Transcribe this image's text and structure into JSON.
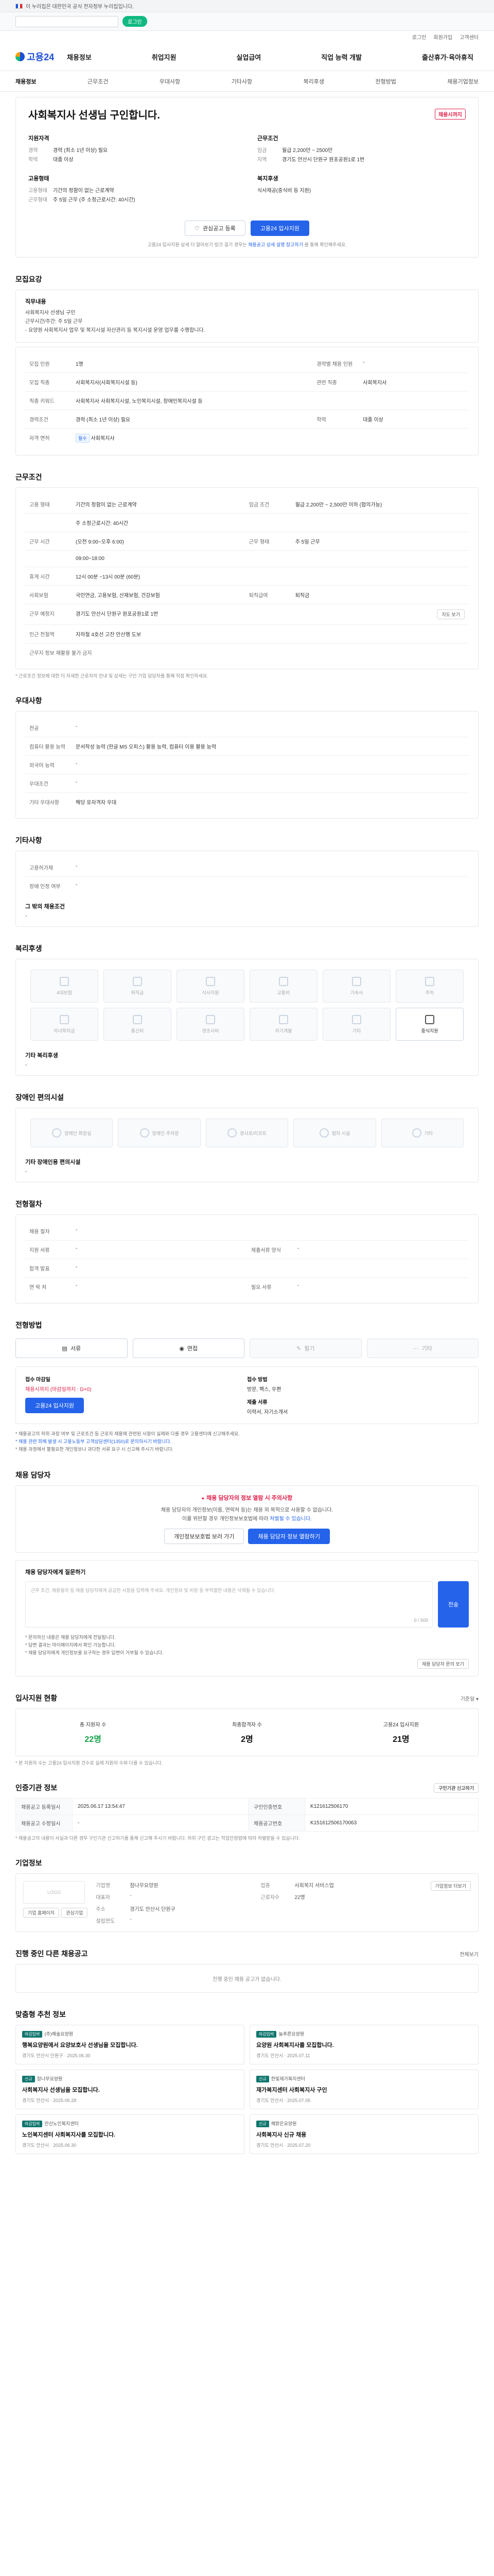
{
  "gov": {
    "text": "이 누리집은 대한민국 공식 전자정부 누리집입니다."
  },
  "notice": {
    "placeholder": "",
    "pill": "로그인"
  },
  "util": [
    "로그인",
    "회원가입",
    "고객센터"
  ],
  "logo": "고용24",
  "gnb": [
    "채용정보",
    "취업지원",
    "실업급여",
    "직업 능력 개발",
    "출산휴가·육아휴직"
  ],
  "subnav": [
    {
      "label": "채용정보",
      "active": true
    },
    {
      "label": "근무조건",
      "active": false
    },
    {
      "label": "우대사항",
      "active": false
    },
    {
      "label": "기타사항",
      "active": false
    },
    {
      "label": "복리후생",
      "active": false
    },
    {
      "label": "전형방법",
      "active": false
    },
    {
      "label": "채용기업정보",
      "active": false
    }
  ],
  "job": {
    "title": "사회복지사 선생님 구인합니다.",
    "tag": "채용시까지",
    "summary": {
      "left_head": "지원자격",
      "left_rows": [
        {
          "k": "경력",
          "v": "경력 (최소 1년 이상) 필요"
        },
        {
          "k": "학력",
          "v": "대졸 이상"
        }
      ],
      "right_head": "근무조건",
      "right_rows": [
        {
          "k": "임금",
          "v": "월급 2,200만 ~ 2500만"
        },
        {
          "k": "지역",
          "v": "경기도 안산시 단원구 원포공원1로 1번"
        }
      ],
      "left_head2": "고용형태",
      "left_rows2": [
        {
          "k": "고용형태",
          "v": "기간의 정함이 없는 근로계약"
        },
        {
          "k": "근무형태",
          "v": "주 5일 근무 (주 소정근로시간: 40시간)"
        }
      ],
      "right_head2": "복지후생",
      "right_rows2": [
        {
          "k": "",
          "v": "식사제공(중식비 등 지원)"
        }
      ]
    },
    "btn_save": "관심공고 등록",
    "btn_apply": "고용24 입사지원",
    "note_pre": "고용24 입사지원 상세 더 알아보기 링크 걸기 경우는",
    "note_link": "채용공고 상세 설명 참고하기",
    "note_post": "를 통해 확인해주세요."
  },
  "sec_recruit": {
    "title": "모집요강",
    "duty_head": "직무내용",
    "duty_lines": [
      "사회복지사 선생님 구인",
      "근무시간/주간: 주 5일 근무",
      "- 요양원 사회복지사 업무 및 복지시설 자산관리 등 복지시설 운영 업무를 수행합니다."
    ],
    "rows": [
      {
        "k": "모집 인원",
        "v": "1명",
        "k2": "경력별 채용 인원",
        "v2": "-"
      },
      {
        "k": "모집 직종",
        "v": "사회복지사(사회복지시설 등)",
        "k2": "관련 직종",
        "v2": "사회복지사"
      },
      {
        "k": "직종 키워드",
        "v": "사회복지사 사회복지시설, 노인복지시설, 장애인복지시설 등",
        "k2": "",
        "v2": ""
      },
      {
        "k": "경력조건",
        "v": "경력 (최소 1년 이상) 필요",
        "k2": "학력",
        "v2": "대졸 이상"
      },
      {
        "k": "자격 면허",
        "v": "사회복지사",
        "k2": "",
        "v2": ""
      }
    ],
    "tag": "필수"
  },
  "sec_work": {
    "title": "근무조건",
    "rows": [
      {
        "k": "고용 형태",
        "v": "기간의 정함이 없는 근로계약",
        "k2": "임금 조건",
        "v2": "월급 2,200만 ~ 2,500만 이하 (협의가능)"
      },
      {
        "k": "",
        "v": "주 소정근로시간: 40시간",
        "k2": "",
        "v2": ""
      },
      {
        "k": "근무 시간",
        "v": "(오전 9:00~오후 6:00)",
        "k2": "근무 형태",
        "v2": "주 5일 근무"
      },
      {
        "k": "",
        "v": "09:00~18:00",
        "k2": "",
        "v2": ""
      },
      {
        "k": "휴게 시간",
        "v": "12시 00분 ~13시 00분 (60분)",
        "k2": "",
        "v2": ""
      },
      {
        "k": "사회보험",
        "v": "국민연금, 고용보험, 산재보험, 건강보험",
        "k2": "퇴직급여",
        "v2": "퇴직금"
      },
      {
        "k": "근무 예정지",
        "v": "경기도 안산시 단원구 원포공원1로 1번",
        "k2": "",
        "v2": ""
      },
      {
        "k": "인근 전철역",
        "v": "지하철 4호선 고잔 안산행 도보",
        "k2": "",
        "v2": ""
      }
    ],
    "sel": "지도 보기",
    "note": "근무지 정보 재활용 불가 금지",
    "footnote": "* 근로조건 정보에 대한 더 자세한 근로자의 안내 및 상세는 구인 기업 담당자를 통해 직접 확인하세요."
  },
  "sec_pref": {
    "title": "우대사항",
    "rows": [
      {
        "k": "전공",
        "v": "-"
      },
      {
        "k": "컴퓨터 활용 능력",
        "v": "문서작성 능력 (한글 MS 오피스) 활용 능력, 컴퓨터 이용 활용 능력"
      },
      {
        "k": "외국어 능력",
        "v": "-"
      },
      {
        "k": "우대조건",
        "v": "-"
      },
      {
        "k": "기타 우대사항",
        "v": "해당 유자격자 우대"
      }
    ]
  },
  "sec_etc": {
    "title": "기타사항",
    "rows": [
      {
        "k": "고용허가제",
        "v": "-"
      },
      {
        "k": "장애 인정 여부",
        "v": "-"
      }
    ],
    "extra_head": "그 밖의 채용조건",
    "extra_v": "-"
  },
  "sec_welfare": {
    "title": "복리후생",
    "items": [
      {
        "label": "4대보험",
        "on": false
      },
      {
        "label": "퇴직금",
        "on": false
      },
      {
        "label": "식사지원",
        "on": false
      },
      {
        "label": "교통비",
        "on": false
      },
      {
        "label": "기숙사",
        "on": false
      },
      {
        "label": "주차",
        "on": false
      },
      {
        "label": "자녀학자금",
        "on": false
      },
      {
        "label": "통신비",
        "on": false
      },
      {
        "label": "경조사비",
        "on": false
      },
      {
        "label": "자기계발",
        "on": false
      },
      {
        "label": "기타",
        "on": false
      },
      {
        "label": "중식지원",
        "on": true
      }
    ],
    "note_head": "기타 복리후생",
    "note_v": "-"
  },
  "sec_disable": {
    "title": "장애인 편의시설",
    "items": [
      "장애인 화장실",
      "장애인 주차장",
      "경사로/리프트",
      "점자 시설",
      "기타"
    ],
    "note_head": "기타 장애인용 편의시설",
    "note_v": "-"
  },
  "sec_screen": {
    "title": "전형절차",
    "rows": [
      {
        "k": "채용 절차",
        "v": "-",
        "k2": "",
        "v2": ""
      },
      {
        "k": "지원 서류",
        "v": "-",
        "k2": "제출서류 양식",
        "v2": "-"
      },
      {
        "k": "합격 발표",
        "v": "-",
        "k2": "",
        "v2": ""
      },
      {
        "k": "연 락 처",
        "v": "-",
        "k2": "필요 서류",
        "v2": "-"
      }
    ]
  },
  "sec_apply": {
    "title": "전형방법",
    "methods": [
      {
        "label": "서류",
        "on": true
      },
      {
        "label": "면접",
        "on": true
      },
      {
        "label": "필기",
        "on": false
      },
      {
        "label": "기타",
        "on": false
      }
    ],
    "deadline_label": "접수 마감일",
    "deadline_v": "채용시까지 (마감일까지 : D+0)",
    "how_label": "접수 방법",
    "how_v": "방문, 팩스, 우편",
    "btn": "고용24 입사지원",
    "doc_label": "제출 서류",
    "doc_v": "이력서, 자기소개서",
    "bullets": [
      "* 채용공고의 허위·과장 여부 및 근로조건 등 근로자 채용에 관련된 사항이 실제와 다를 경우 고용센터에 신고해주세요.",
      "* 채용 관련 피해 발생 시 고용노동부 고객상담센터(1350)로 문의하시기 바랍니다.",
      "* 채용 과정에서 불필요한 개인정보나 과다한 서류 요구 시 신고해 주시기 바랍니다."
    ]
  },
  "caution": {
    "title": "채용 담당자",
    "head": "채용 담당자의 정보 열람 시 주의사항",
    "l1": "채용 담당자의 개인정보(이름, 연락처 등)는 채용 외 목적으로 사용할 수 없습니다.",
    "l2_pre": "이를 위반할 경우 개인정보보호법에 따라",
    "l2_b": "처벌될 수 있습니다.",
    "btn1": "개인정보보호법 보러 가기",
    "btn2": "채용 담당자 정보 열람하기"
  },
  "inq": {
    "head": "채용 담당자에게 질문하기",
    "placeholder": "근무 조건, 채용절차 등 채용 담당자에게 궁금한 사항을 입력해 주세요. 개인정보 및 비방 등 부적절한 내용은 삭제될 수 있습니다.",
    "count": "0 / 500",
    "send": "전송",
    "notes": [
      "* 문의하신 내용은 채용 담당자에게 전달됩니다.",
      "* 답변 결과는 마이페이지에서 확인 가능합니다.",
      "* 채용 담당자에게 개인정보를 요구하는 경우 답변이 거부될 수 있습니다."
    ],
    "btn": "채용 담당자 문의 보기"
  },
  "stats": {
    "title": "입사지원 현황",
    "right": "기준일 ▾",
    "items": [
      {
        "t": "총 지원자 수",
        "n": "22명",
        "c": "g"
      },
      {
        "t": "최종합격자 수",
        "n": "2명",
        "c": "b"
      },
      {
        "t": "고용24 입사지원",
        "n": "21명",
        "c": "b"
      }
    ],
    "note": "* 본 지원자 수는 고용24 입사지원 건수로 실제 지원자 수와 다를 수 있습니다."
  },
  "info": {
    "title": "인증기관 정보",
    "right": "구인기관 신고하기",
    "rows": [
      {
        "k": "채용공고 등록일시",
        "v": "2025.06.17 13:54:47",
        "k2": "구인인증번호",
        "v2": "K121612506170"
      },
      {
        "k": "채용공고 수정일시",
        "v": "-",
        "k2": "채용공고번호",
        "v2": "K151612506170063"
      }
    ],
    "footnote": "* 채용공고의 내용이 사실과 다른 경우 구인기관 신고하기를 통해 신고해 주시기 바랍니다. 허위 구인 광고는 직업안정법에 따라 처벌받을 수 있습니다."
  },
  "corp": {
    "title": "기업정보",
    "logo": "LOGO",
    "rows": [
      {
        "k": "기업명",
        "v": "참나무요양원",
        "k2": "업종",
        "v2": "사회복지 서비스업"
      },
      {
        "k": "대표자",
        "v": "-",
        "k2": "근로자수",
        "v2": "22명"
      },
      {
        "k": "주소",
        "v": "경기도 안산시 단원구",
        "k2": "",
        "v2": ""
      },
      {
        "k": "설립연도",
        "v": "-",
        "k2": "",
        "v2": ""
      }
    ],
    "btn": "기업정보 더보기",
    "btn_a": "기업 홈페이지",
    "btn_b": "관심기업"
  },
  "ongoing": {
    "title": "진행 중인 다른 채용공고",
    "right": "전체보기",
    "empty": "진행 중인 채용 공고가 없습니다."
  },
  "recs": {
    "title": "맞춤형 추천 정보",
    "items": [
      {
        "badge": "마감임박",
        "org": "(주)해솔요양원",
        "t": "행복요양원에서 요양보호사 선생님을 모집합니다.",
        "m": "경기도 안산시 단원구 · 2025.06.30"
      },
      {
        "badge": "마감임박",
        "org": "늘푸른요양원",
        "t": "요양원 사회복지사를 모집합니다.",
        "m": "경기도 안산시 · 2025.07.11"
      },
      {
        "badge": "신규",
        "org": "참나무요양원",
        "t": "사회복지사 선생님을 모집합니다.",
        "m": "경기도 안산시 · 2025.06.28"
      },
      {
        "badge": "신규",
        "org": "한빛재가복지센터",
        "t": "재가복지센터 사회복지사 구인",
        "m": "경기도 안산시 · 2025.07.05"
      },
      {
        "badge": "마감임박",
        "org": "안산노인복지센터",
        "t": "노인복지센터 사회복지사를 모집합니다.",
        "m": "경기도 안산시 · 2025.06.30"
      },
      {
        "badge": "신규",
        "org": "해맑은요양원",
        "t": "사회복지사 신규 채용",
        "m": "경기도 안산시 · 2025.07.20"
      }
    ]
  }
}
